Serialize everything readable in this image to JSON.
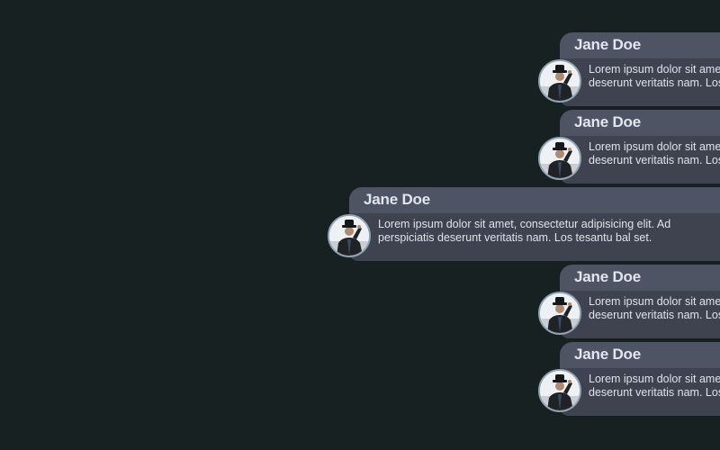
{
  "messages": [
    {
      "name": "Jane Doe",
      "text": "Lorem ipsum dolor sit amet, consectetur adipisicing elit. Ad perspiciatis deserunt veritatis nam. Los tesantu bal set.",
      "avatar_icon": "person-in-hat-photo",
      "expanded": false
    },
    {
      "name": "Jane Doe",
      "text": "Lorem ipsum dolor sit amet, consectetur adipisicing elit. Ad perspiciatis deserunt veritatis nam. Los tesantu bal set.",
      "avatar_icon": "person-in-hat-photo",
      "expanded": false
    },
    {
      "name": "Jane Doe",
      "text": "Lorem ipsum dolor sit amet, consectetur adipisicing elit. Ad perspiciatis deserunt veritatis nam. Los tesantu bal set.",
      "avatar_icon": "person-in-hat-photo",
      "expanded": true
    },
    {
      "name": "Jane Doe",
      "text": "Lorem ipsum dolor sit amet, consectetur adipisicing elit. Ad perspiciatis deserunt veritatis nam. Los tesantu bal set.",
      "avatar_icon": "person-in-hat-photo",
      "expanded": false
    },
    {
      "name": "Jane Doe",
      "text": "Lorem ipsum dolor sit amet, consectetur adipisicing elit. Ad perspiciatis deserunt veritatis nam. Los tesantu bal set.",
      "avatar_icon": "person-in-hat-photo",
      "expanded": false
    }
  ],
  "colors": {
    "background": "#172122",
    "header": "#4e5463",
    "body": "#3f4350",
    "name_text": "#e3e6ee",
    "message_text": "#dfe3ea",
    "avatar_border": "#8fa3b2"
  }
}
